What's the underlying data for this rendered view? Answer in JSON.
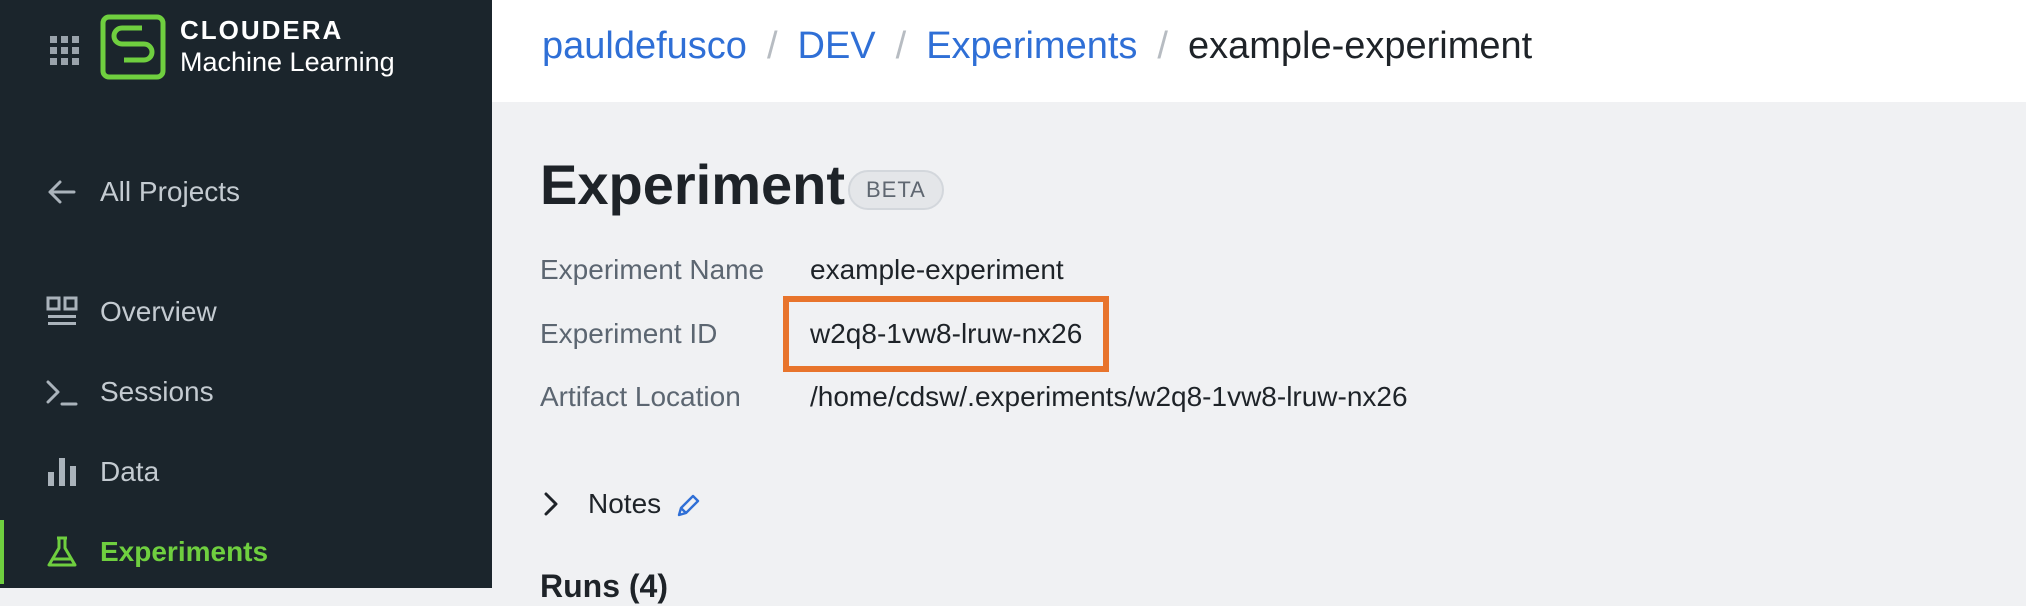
{
  "brand": {
    "name_top": "CLOUDERA",
    "name_bottom": "Machine Learning",
    "accent": "#6fcf3f"
  },
  "sidebar": {
    "back_label": "All Projects",
    "items": [
      {
        "label": "Overview",
        "icon": "overview-icon"
      },
      {
        "label": "Sessions",
        "icon": "terminal-icon"
      },
      {
        "label": "Data",
        "icon": "bar-chart-icon"
      },
      {
        "label": "Experiments",
        "icon": "flask-icon",
        "active": true
      }
    ]
  },
  "breadcrumb": [
    "pauldefusco",
    "DEV",
    "Experiments",
    "example-experiment"
  ],
  "page": {
    "title": "Experiment",
    "badge": "BETA",
    "fields": [
      {
        "label": "Experiment Name",
        "value": "example-experiment"
      },
      {
        "label": "Experiment ID",
        "value": "w2q8-1vw8-lruw-nx26"
      },
      {
        "label": "Artifact Location",
        "value": "/home/cdsw/.experiments/w2q8-1vw8-lruw-nx26"
      }
    ],
    "notes_label": "Notes",
    "runs_heading": "Runs (4)"
  },
  "highlight_color": "#e8742c"
}
